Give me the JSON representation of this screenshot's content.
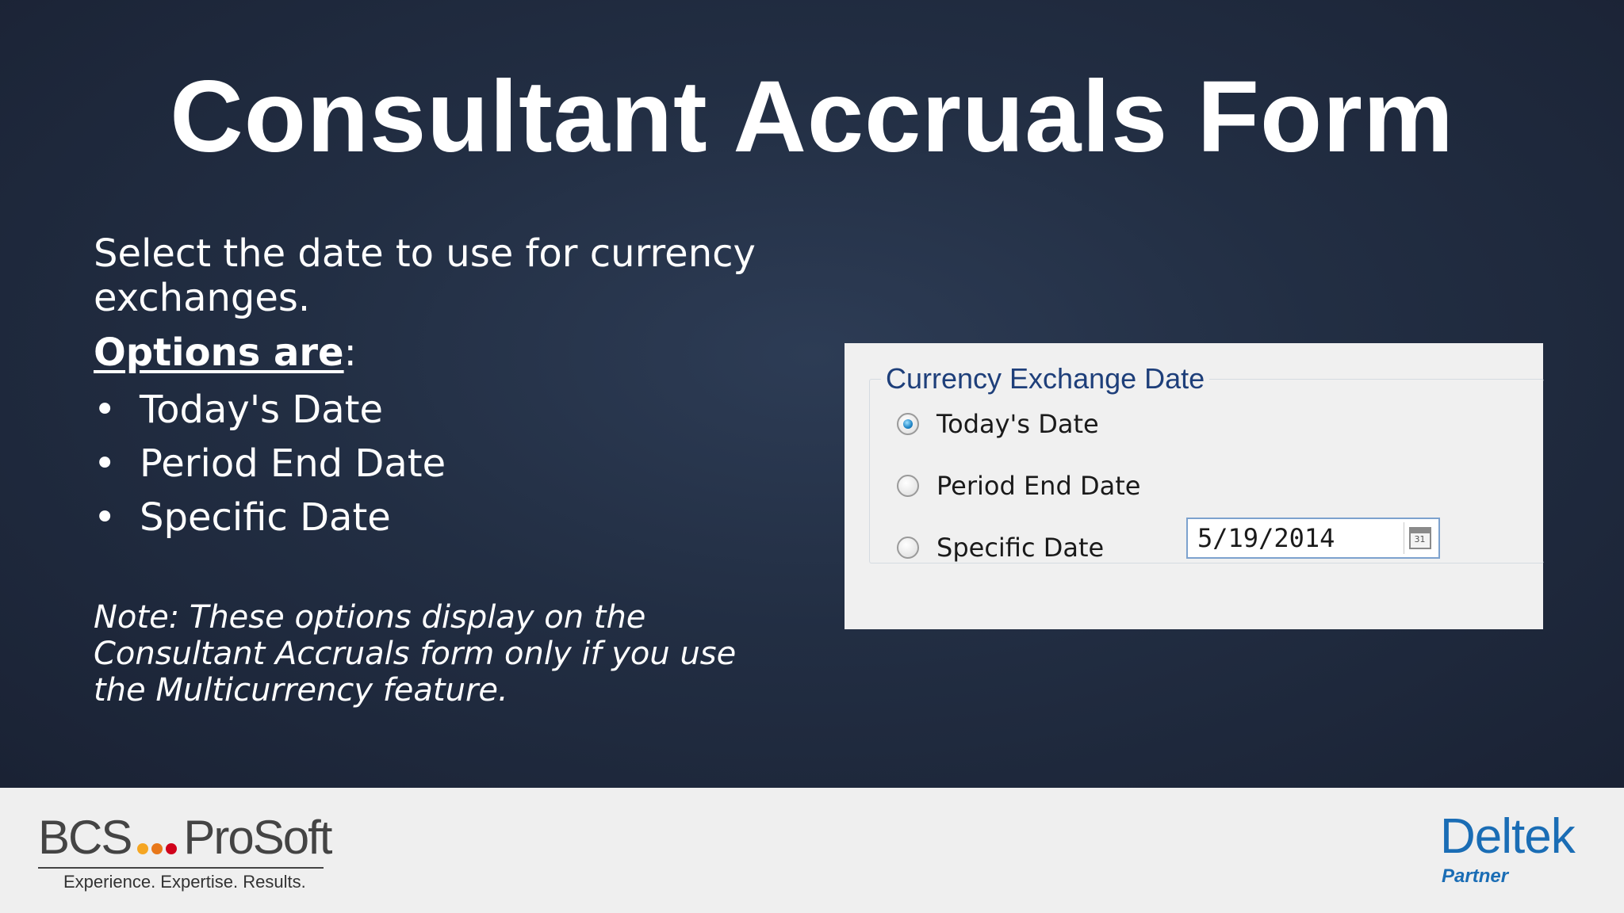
{
  "slide": {
    "title": "Consultant Accruals Form",
    "intro": "Select the date to use for currency exchanges.",
    "options_heading": "Options are",
    "options_colon": ":",
    "bullet_char": "•",
    "options": [
      "Today's Date",
      "Period End Date",
      "Specific Date"
    ],
    "note": "Note: These options display on the Consultant Accruals form only if you use the Multicurrency feature."
  },
  "dialog": {
    "group_title": "Currency Exchange Date",
    "radio_options": [
      {
        "label": "Today's Date",
        "checked": true
      },
      {
        "label": "Period End Date",
        "checked": false
      },
      {
        "label": "Specific Date",
        "checked": false
      }
    ],
    "date_value": "5/19/2014",
    "calendar_icon_text": "31",
    "calendar_icon": "calendar-icon"
  },
  "footer": {
    "bcs_left": "BCS",
    "bcs_right": "ProSoft",
    "bcs_dot_colors": [
      "#f5a623",
      "#e8781a",
      "#d0021b"
    ],
    "bcs_tagline": "Experience. Expertise. Results.",
    "deltek_name": "Deltek",
    "deltek_partner": "Partner"
  },
  "colors": {
    "slide_background": "#222e43",
    "deltek_blue": "#1a6db5",
    "group_title": "#1e3f7a"
  }
}
